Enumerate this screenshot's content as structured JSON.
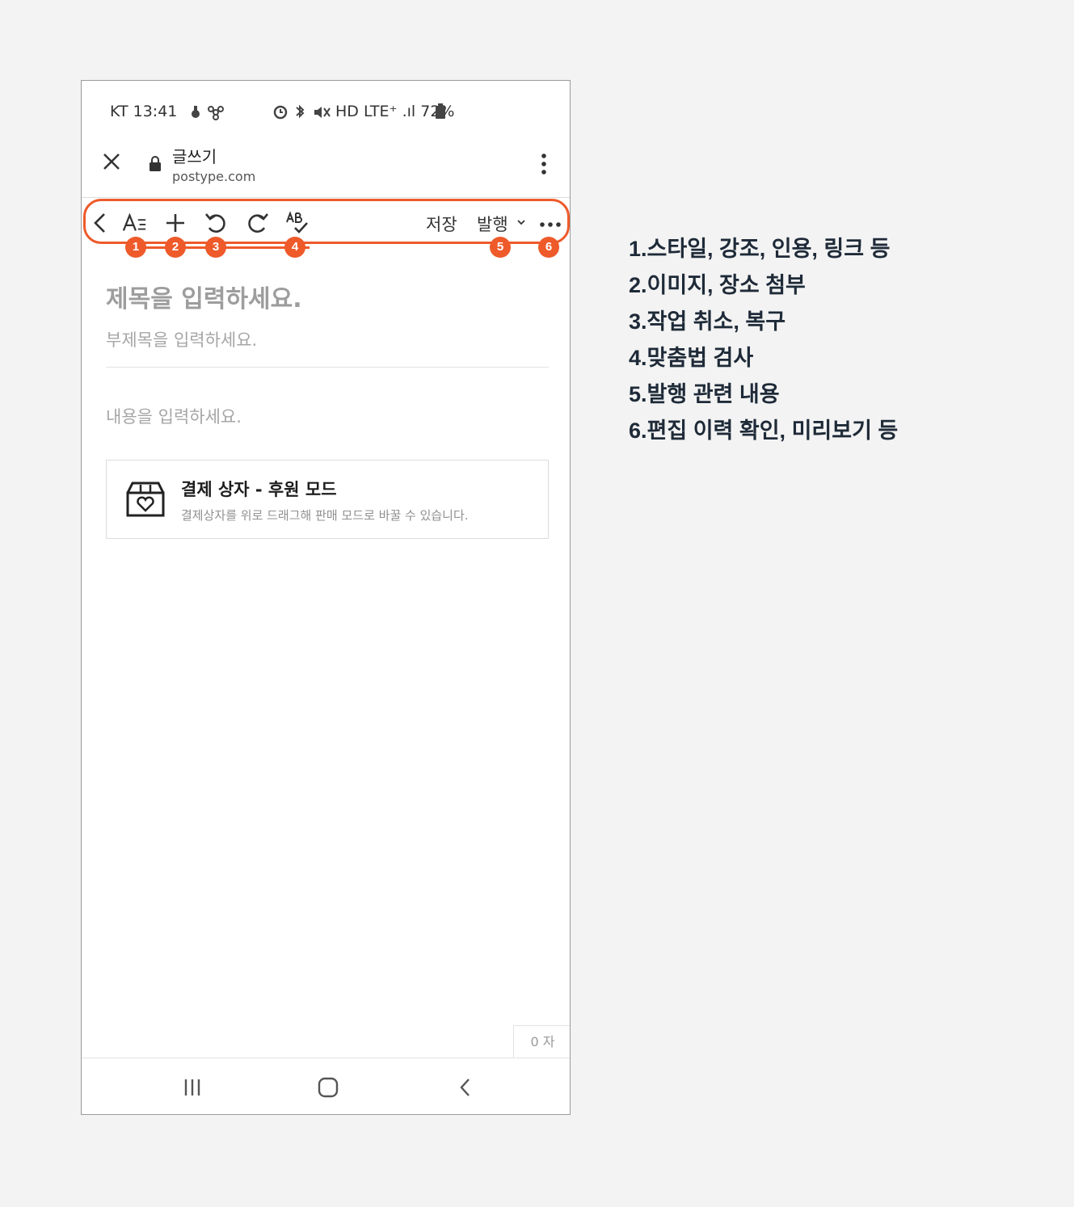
{
  "status_bar": {
    "carrier_time": "KT 13:41",
    "right": "HD LTE⁺ .ıl 72%"
  },
  "url_bar": {
    "page_title": "글쓰기",
    "host": "postype.com"
  },
  "toolbar": {
    "save_label": "저장",
    "publish_label": "발행"
  },
  "badges": [
    "1",
    "2",
    "3",
    "4",
    "5",
    "6"
  ],
  "editor": {
    "title_placeholder": "제목을 입력하세요.",
    "subtitle_placeholder": "부제목을 입력하세요.",
    "body_placeholder": "내용을 입력하세요."
  },
  "payment_box": {
    "title": "결제 상자 - 후원 모드",
    "description": "결제상자를 위로 드래그해 판매 모드로 바꿀 수 있습니다."
  },
  "char_count": "0 자",
  "legend": [
    "1.스타일, 강조, 인용, 링크 등",
    "2.이미지, 장소 첨부",
    "3.작업 취소, 복구",
    "4.맞춤법 검사",
    "5.발행 관련 내용",
    "6.편집 이력 확인, 미리보기 등"
  ],
  "colors": {
    "annotation": "#ee5a2a",
    "legend_text": "#1e2a38",
    "background": "#f3f3f3"
  }
}
